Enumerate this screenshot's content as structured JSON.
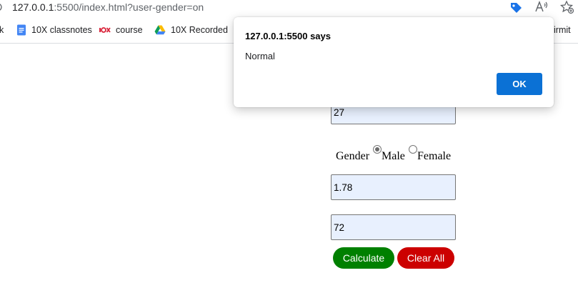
{
  "browser": {
    "url_host": "127.0.0.1",
    "url_rest": ":5500/index.html?user-gender=on",
    "bookmarks": [
      {
        "label": "k",
        "icon": "bookmark-partial"
      },
      {
        "label": "10X classnotes",
        "icon": "google-docs-icon"
      },
      {
        "label": "course",
        "icon": "10x-logo-icon"
      },
      {
        "label": "10X Recorded",
        "icon": "google-drive-icon"
      },
      {
        "label": "irmit",
        "icon": "bookmark-partial"
      }
    ],
    "toolbar_icons": [
      "tag-icon",
      "read-aloud-icon",
      "favorite-add-icon"
    ]
  },
  "form": {
    "age_value": "27",
    "gender_label": "Gender",
    "male_label": "Male",
    "female_label": "Female",
    "selected_gender": "Male",
    "height_value": "1.78",
    "weight_value": "72",
    "calculate_label": "Calculate",
    "clear_label": "Clear All",
    "colors": {
      "calculate": "#008000",
      "clear": "#cc0000",
      "input_bg": "#e8f0fe"
    }
  },
  "alert": {
    "title": "127.0.0.1:5500 says",
    "message": "Normal",
    "ok_label": "OK",
    "ok_color": "#0b71d5"
  }
}
